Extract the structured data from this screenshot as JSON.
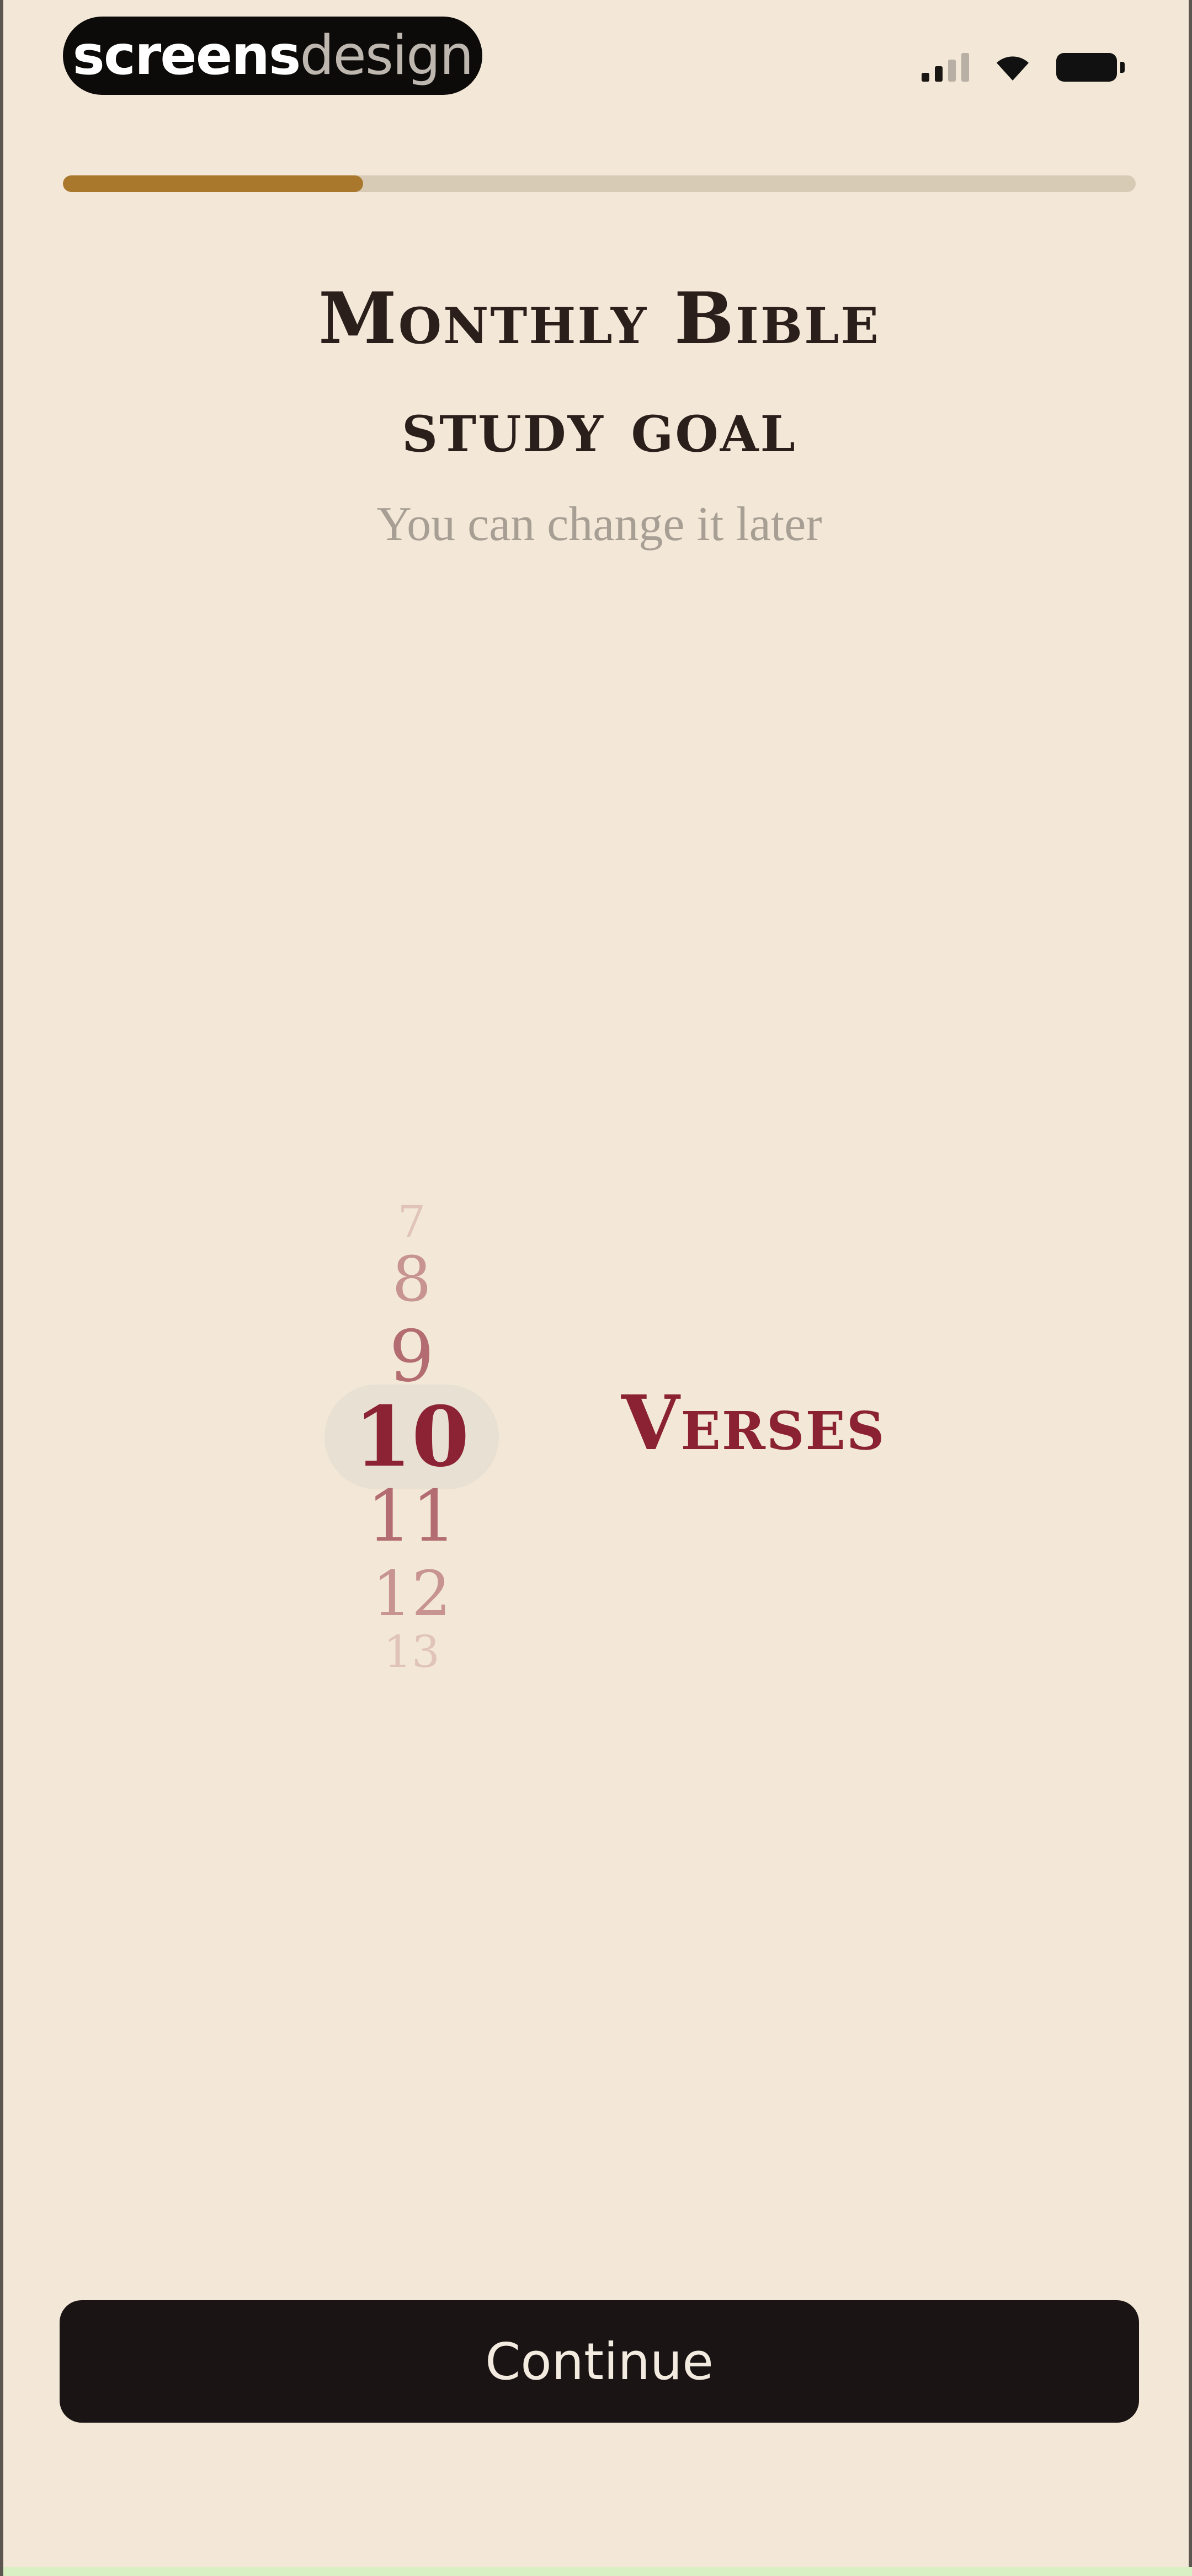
{
  "status_bar": {
    "brand_bold": "screens",
    "brand_light": "design"
  },
  "progress": {
    "fraction": 0.28
  },
  "header": {
    "title_line1": "Monthly Bible",
    "title_line2": "study goal",
    "subtitle": "You can change it later"
  },
  "picker": {
    "items": [
      "7",
      "8",
      "9",
      "10",
      "11",
      "12",
      "13"
    ],
    "selected": "10",
    "unit_label": "Verses"
  },
  "footer": {
    "continue_label": "Continue"
  },
  "colors": {
    "background": "#f3e8d7",
    "accent": "#8b2233",
    "progress_fill": "#a9782c",
    "button": "#1a1514"
  }
}
